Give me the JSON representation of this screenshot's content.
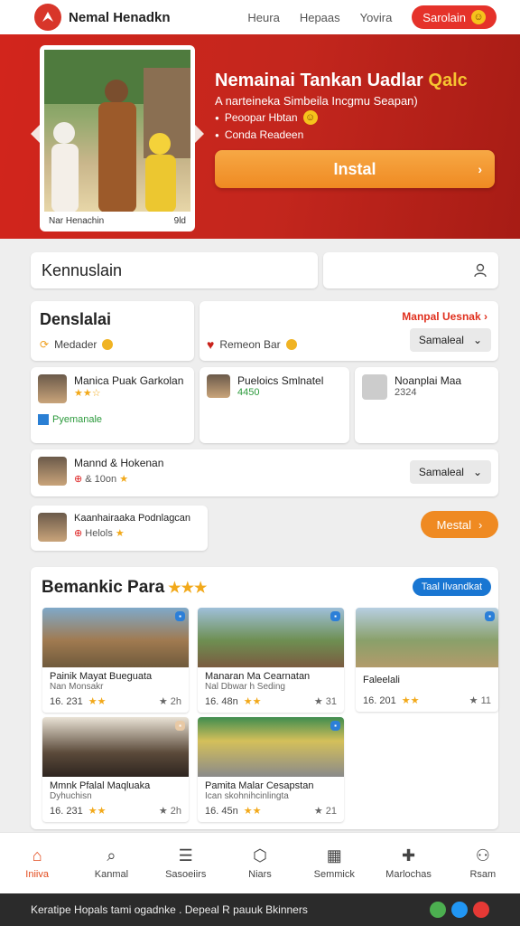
{
  "header": {
    "brand": "Nemal Henadkn",
    "nav": [
      "Heura",
      "Hepaas",
      "Yovira"
    ],
    "cta": "Sarolain"
  },
  "hero": {
    "photo_caption_left": "Nar Henachin",
    "photo_caption_right": "9ld",
    "title_main": "Nemainai Tankan Uadlar",
    "title_highlight": "Qalc",
    "subtitle": "A narteineka Simbeila Incgmu Seapan)",
    "bullet1": "Peoopar Hbtan",
    "bullet2": "Conda Readeen",
    "install_label": "Instal"
  },
  "search": {
    "title": "Kennuslain"
  },
  "section1": {
    "title": "Denslalai",
    "item": "Medader"
  },
  "section2": {
    "link": "Manpal Uesnak",
    "item": "Remeon Bar",
    "select": "Samaleal"
  },
  "people": [
    {
      "name": "Manica Puak Garkolan",
      "extra": "Pyemanale"
    },
    {
      "name": "Pueloics Smlnatel",
      "num": "4450"
    },
    {
      "name": "Noanplai Maa",
      "num": "2324"
    }
  ],
  "row3": {
    "name": "Mannd & Hokenan",
    "sub": "& 10on",
    "select": "Samaleal"
  },
  "row4": {
    "name": "Kaanhairaaka Podnlagcan",
    "sub": "Helols",
    "btn": "Mestal"
  },
  "grid": {
    "title": "Bemankic Para",
    "view": "Taal Ilvandkat",
    "tiles": [
      {
        "title": "Painik Mayat Bueguata",
        "sub": "Nan Monsakr",
        "num": "16. 231",
        "right": "2h"
      },
      {
        "title": "Manaran Ma Cearnatan",
        "sub": "Nal Dbwar h Seding",
        "num": "16. 48n",
        "right": "31"
      },
      {
        "title": "Faleelali",
        "sub": "",
        "num": "16. 201",
        "right": "11"
      },
      {
        "title": "Mmnk Pfalal Maqluaka",
        "sub": "Dyhuchisn",
        "num": "16. 231",
        "right": "2h"
      },
      {
        "title": "Pamita Malar Cesapstan",
        "sub": "Ican skohnihcinlingta",
        "num": "16. 45n",
        "right": "21"
      }
    ]
  },
  "bottomnav": [
    "Iniiva",
    "Kanmal",
    "Sasoeiirs",
    "Niars",
    "Semmick",
    "Marlochas",
    "Rsam"
  ],
  "footer": "Keratipe Hopals tami ogadnke . Depeal R pauuk Bkinners"
}
